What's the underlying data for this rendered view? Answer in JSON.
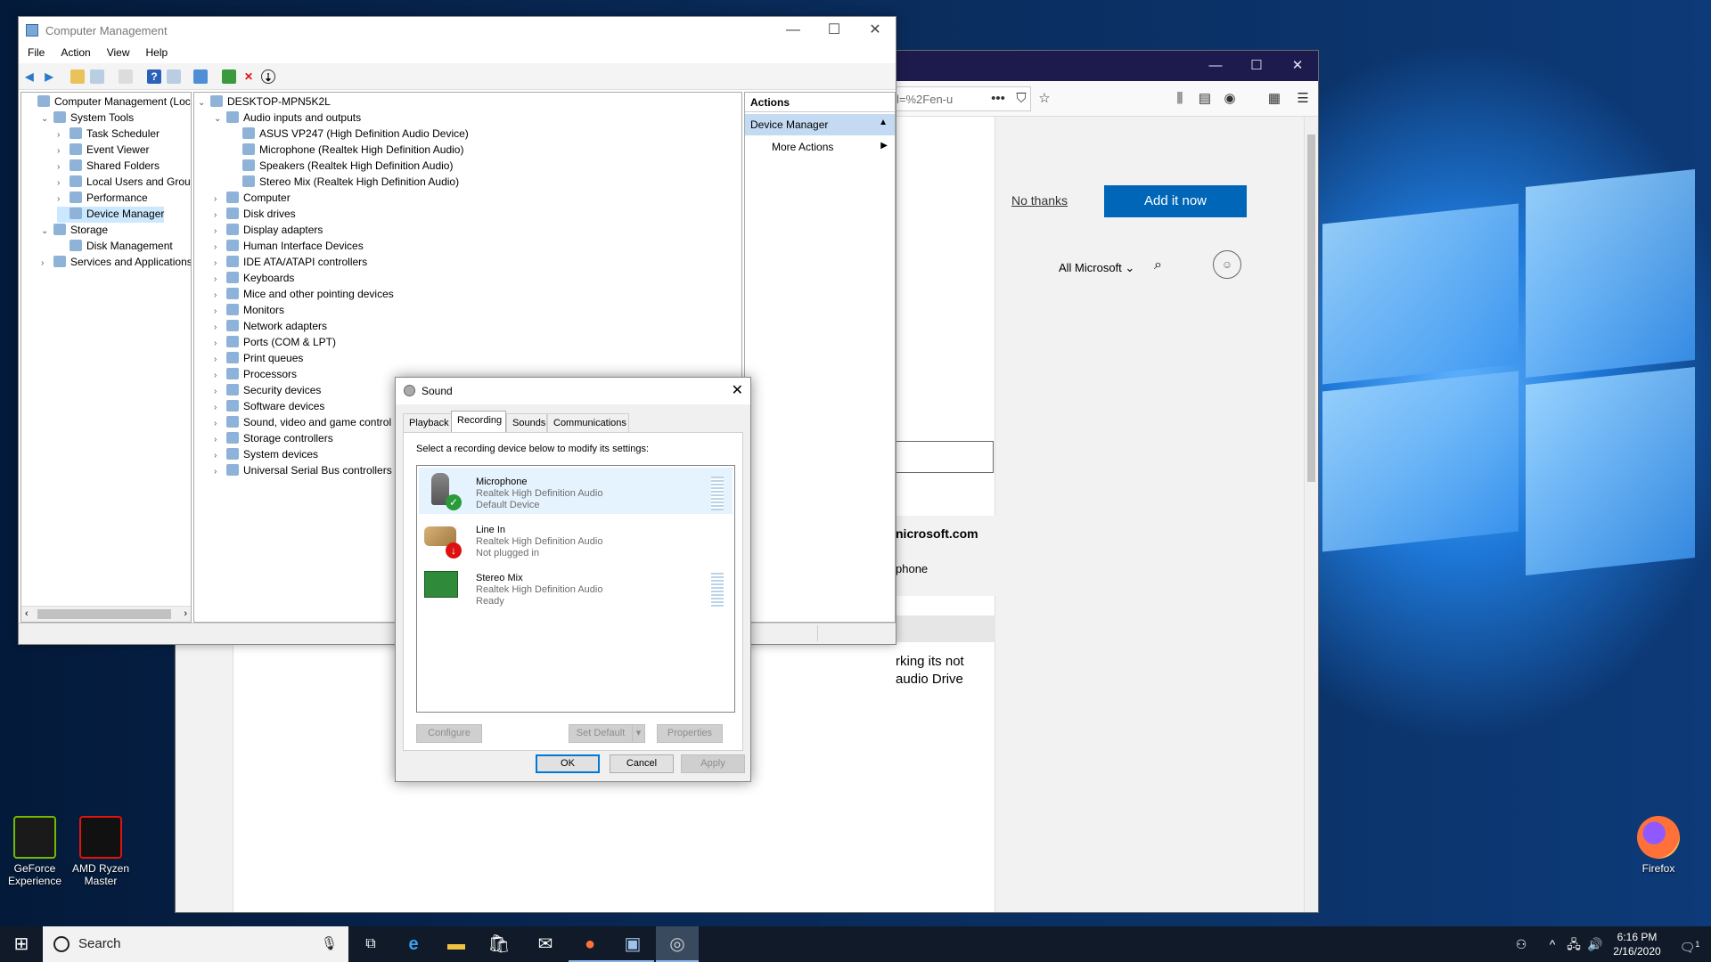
{
  "desktop": {
    "icons": [
      {
        "label": "GeForce\nExperience",
        "icon": "geforce-icon",
        "color": "#76b900"
      },
      {
        "label": "AMD Ryzen\nMaster",
        "icon": "ryzen-icon",
        "color": "#e3120b"
      },
      {
        "label": "Firefox",
        "icon": "firefox-icon",
        "color": "#ff7139"
      }
    ]
  },
  "firefox": {
    "url_text": "l=%2Fen-u",
    "no_thanks": "No thanks",
    "add_it_now": "Add it now",
    "all_microsoft": "All Microsoft",
    "email_fragment": "nicrosoft.com",
    "phone_fragment": "phone",
    "body_line1": "rking its not",
    "body_line2": "audio Drive",
    "accent": "#0067b8"
  },
  "mmc": {
    "title": "Computer Management",
    "menu": [
      "File",
      "Action",
      "View",
      "Help"
    ],
    "tree": [
      {
        "label": "Computer Management (Local",
        "level": 0,
        "expander": "",
        "icon": "computer-management-icon"
      },
      {
        "label": "System Tools",
        "level": 1,
        "expander": "⌄",
        "icon": "system-tools-icon"
      },
      {
        "label": "Task Scheduler",
        "level": 2,
        "expander": "›",
        "icon": "task-scheduler-icon"
      },
      {
        "label": "Event Viewer",
        "level": 2,
        "expander": "›",
        "icon": "event-viewer-icon"
      },
      {
        "label": "Shared Folders",
        "level": 2,
        "expander": "›",
        "icon": "shared-folders-icon"
      },
      {
        "label": "Local Users and Groups",
        "level": 2,
        "expander": "›",
        "icon": "users-icon"
      },
      {
        "label": "Performance",
        "level": 2,
        "expander": "›",
        "icon": "performance-icon"
      },
      {
        "label": "Device Manager",
        "level": 2,
        "expander": "",
        "icon": "device-manager-icon",
        "selected": true
      },
      {
        "label": "Storage",
        "level": 1,
        "expander": "⌄",
        "icon": "storage-icon"
      },
      {
        "label": "Disk Management",
        "level": 2,
        "expander": "",
        "icon": "disk-management-icon"
      },
      {
        "label": "Services and Applications",
        "level": 1,
        "expander": "›",
        "icon": "services-icon"
      }
    ],
    "devices": [
      {
        "label": "DESKTOP-MPN5K2L",
        "level": 0,
        "expander": "⌄",
        "icon": "computer-icon"
      },
      {
        "label": "Audio inputs and outputs",
        "level": 1,
        "expander": "⌄",
        "icon": "speaker-icon"
      },
      {
        "label": "ASUS VP247 (High Definition Audio Device)",
        "level": 2,
        "expander": "",
        "icon": "monitor-audio-icon"
      },
      {
        "label": "Microphone (Realtek High Definition Audio)",
        "level": 2,
        "expander": "",
        "icon": "microphone-icon"
      },
      {
        "label": "Speakers (Realtek High Definition Audio)",
        "level": 2,
        "expander": "",
        "icon": "speaker-icon"
      },
      {
        "label": "Stereo Mix (Realtek High Definition Audio)",
        "level": 2,
        "expander": "",
        "icon": "stereo-mix-icon"
      },
      {
        "label": "Computer",
        "level": 1,
        "expander": "›",
        "icon": "computer-icon"
      },
      {
        "label": "Disk drives",
        "level": 1,
        "expander": "›",
        "icon": "disk-drive-icon"
      },
      {
        "label": "Display adapters",
        "level": 1,
        "expander": "›",
        "icon": "display-adapter-icon"
      },
      {
        "label": "Human Interface Devices",
        "level": 1,
        "expander": "›",
        "icon": "hid-icon"
      },
      {
        "label": "IDE ATA/ATAPI controllers",
        "level": 1,
        "expander": "›",
        "icon": "ide-icon"
      },
      {
        "label": "Keyboards",
        "level": 1,
        "expander": "›",
        "icon": "keyboard-icon"
      },
      {
        "label": "Mice and other pointing devices",
        "level": 1,
        "expander": "›",
        "icon": "mouse-icon"
      },
      {
        "label": "Monitors",
        "level": 1,
        "expander": "›",
        "icon": "monitor-icon"
      },
      {
        "label": "Network adapters",
        "level": 1,
        "expander": "›",
        "icon": "network-icon"
      },
      {
        "label": "Ports (COM & LPT)",
        "level": 1,
        "expander": "›",
        "icon": "port-icon"
      },
      {
        "label": "Print queues",
        "level": 1,
        "expander": "›",
        "icon": "printer-icon"
      },
      {
        "label": "Processors",
        "level": 1,
        "expander": "›",
        "icon": "processor-icon"
      },
      {
        "label": "Security devices",
        "level": 1,
        "expander": "›",
        "icon": "security-icon"
      },
      {
        "label": "Software devices",
        "level": 1,
        "expander": "›",
        "icon": "software-icon"
      },
      {
        "label": "Sound, video and game control",
        "level": 1,
        "expander": "›",
        "icon": "sound-icon"
      },
      {
        "label": "Storage controllers",
        "level": 1,
        "expander": "›",
        "icon": "storage-controller-icon"
      },
      {
        "label": "System devices",
        "level": 1,
        "expander": "›",
        "icon": "system-devices-icon"
      },
      {
        "label": "Universal Serial Bus controllers",
        "level": 1,
        "expander": "›",
        "icon": "usb-icon"
      }
    ],
    "actions": {
      "header": "Actions",
      "section": "Device Manager",
      "item": "More Actions"
    }
  },
  "sound": {
    "title": "Sound",
    "tabs": [
      "Playback",
      "Recording",
      "Sounds",
      "Communications"
    ],
    "instruction": "Select a recording device below to modify its settings:",
    "devices": [
      {
        "name": "Microphone",
        "driver": "Realtek High Definition Audio",
        "status": "Default Device"
      },
      {
        "name": "Line In",
        "driver": "Realtek High Definition Audio",
        "status": "Not plugged in"
      },
      {
        "name": "Stereo Mix",
        "driver": "Realtek High Definition Audio",
        "status": "Ready"
      }
    ],
    "buttons": {
      "configure": "Configure",
      "set_default": "Set Default",
      "properties": "Properties",
      "ok": "OK",
      "cancel": "Cancel",
      "apply": "Apply"
    }
  },
  "taskbar": {
    "search_placeholder": "Search",
    "time": "6:16 PM",
    "date": "2/16/2020",
    "notification_count": "1"
  }
}
